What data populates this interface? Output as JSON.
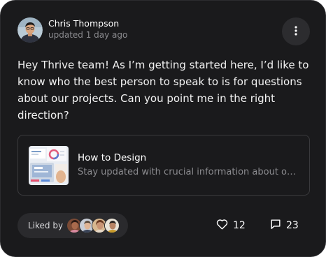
{
  "post": {
    "author_name": "Chris Thompson",
    "meta": "updated 1 day ago",
    "text": "Hey Thrive team! As I’m getting started here, I’d like to know who the best person to speak to is for questions about our projects. Can you point me in the right direction?"
  },
  "attachment": {
    "title": "How to Design",
    "description": "Stay updated with crucial information about our projects"
  },
  "footer": {
    "liked_by_label": "Liked by",
    "likes_count": "12",
    "comments_count": "23"
  },
  "icons": {
    "more": "more-vertical-icon",
    "like": "heart-icon",
    "comment": "comment-icon"
  },
  "colors": {
    "card_background": "#1a1a1c",
    "secondary_text": "#8b8b8f",
    "button_background": "#2c2c2f"
  }
}
